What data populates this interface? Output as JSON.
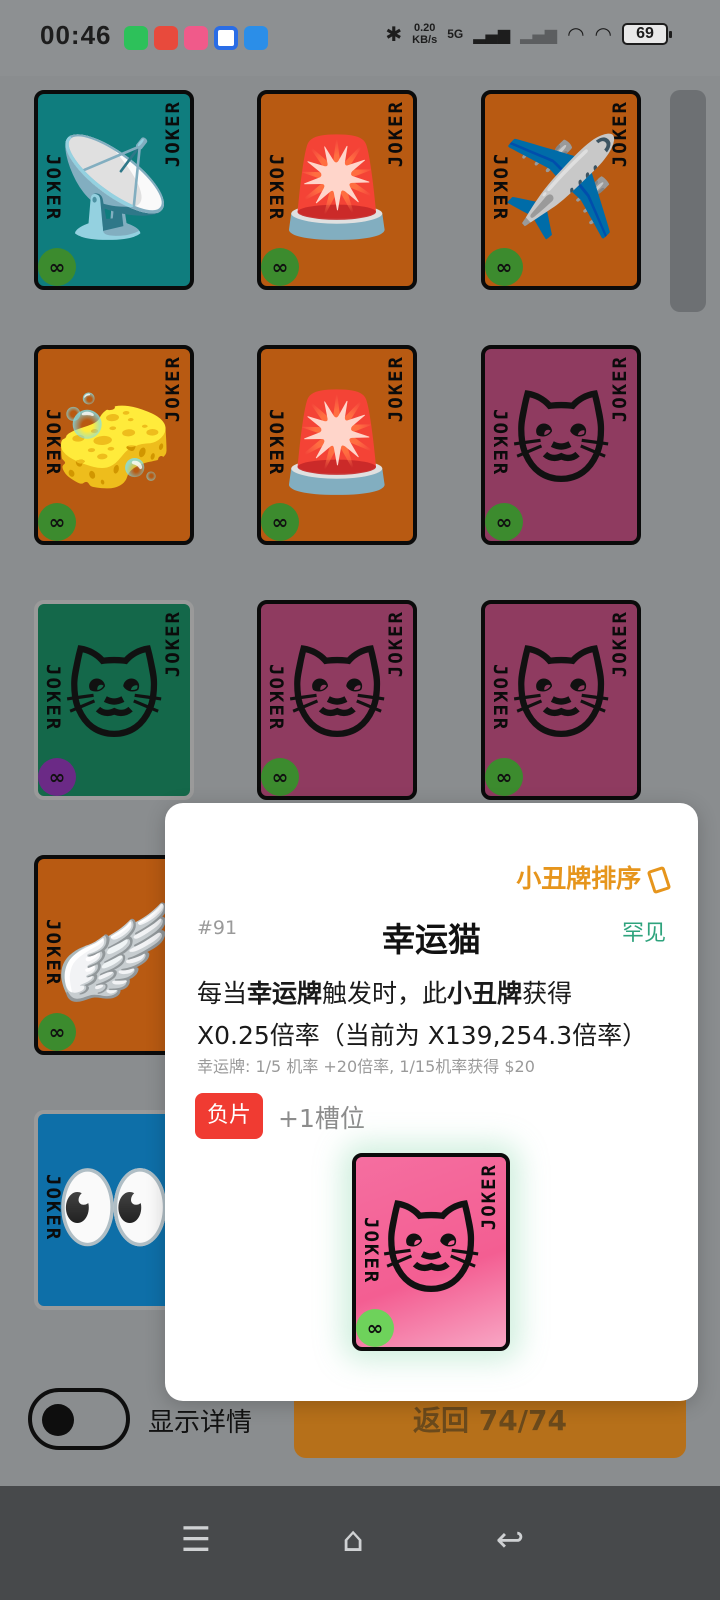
{
  "status_bar": {
    "time": "00:46",
    "net_speed": "0.20",
    "net_unit": "KB/s",
    "network": "5G",
    "battery": "69"
  },
  "cards": [
    {
      "emoji": "📡",
      "color": "teal",
      "label": "JOKER",
      "badge": "∞"
    },
    {
      "emoji": "🚨",
      "color": "orange",
      "label": "JOKER",
      "badge": "∞"
    },
    {
      "emoji": "✈️",
      "color": "orange",
      "label": "JOKER",
      "badge": "∞"
    },
    {
      "emoji": "🧽",
      "color": "orange",
      "label": "JOKER",
      "badge": "∞"
    },
    {
      "emoji": "🚨",
      "color": "orange",
      "label": "JOKER",
      "badge": "∞"
    },
    {
      "emoji": "🐱",
      "color": "magenta",
      "label": "JOKER",
      "badge": "∞"
    },
    {
      "emoji": "🐱",
      "color": "green",
      "label": "JOKER",
      "badge": "∞"
    },
    {
      "emoji": "🐱",
      "color": "magenta",
      "label": "JOKER",
      "badge": "∞"
    },
    {
      "emoji": "🐱",
      "color": "magenta",
      "label": "JOKER",
      "badge": "∞"
    },
    {
      "emoji": "🪽",
      "color": "orange",
      "label": "JOKER",
      "badge": "∞"
    },
    {
      "emoji": "👀",
      "color": "blue",
      "label": "JOKER",
      "badge": ""
    }
  ],
  "bottom": {
    "toggle_label": "显示详情",
    "back_button": "返回 74/74"
  },
  "detail": {
    "sort_link": "小丑牌排序",
    "number": "#91",
    "title": "幸运猫",
    "rarity": "罕见",
    "desc_prefix": "每当",
    "desc_bold1": "幸运牌",
    "desc_mid": "触发时，此",
    "desc_bold2": "小丑牌",
    "desc_suffix": "获得",
    "desc_line2": "X0.25倍率（当前为 X139,254.3倍率）",
    "sub_note": "幸运牌: 1/5 机率 +20倍率, 1/15机率获得 $20",
    "badge": "负片",
    "slot": "+1槽位",
    "card_label": "JOKER",
    "card_badge": "∞"
  }
}
